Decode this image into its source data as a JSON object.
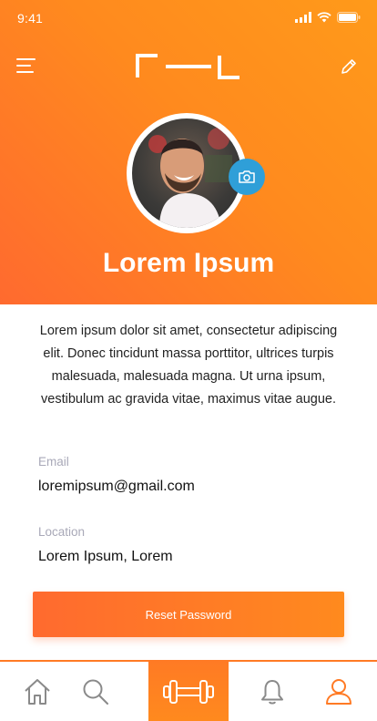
{
  "status_bar": {
    "time": "9:41"
  },
  "header": {
    "profile_name": "Lorem Ipsum"
  },
  "profile": {
    "bio": "Lorem ipsum dolor sit amet, consectetur adipiscing elit. Donec tincidunt massa porttitor, ultrices turpis malesuada, malesuada magna. Ut urna ipsum, vestibulum ac gravida vitae, maximus vitae augue.",
    "email_label": "Email",
    "email_value": "loremipsum@gmail.com",
    "location_label": "Location",
    "location_value": "Lorem Ipsum, Lorem"
  },
  "actions": {
    "reset_password_label": "Reset Password"
  },
  "tabs": [
    {
      "icon": "home-icon",
      "active": false
    },
    {
      "icon": "search-icon",
      "active": false
    },
    {
      "icon": "dumbbell-icon",
      "active": false
    },
    {
      "icon": "bell-icon",
      "active": false
    },
    {
      "icon": "user-icon",
      "active": true
    }
  ],
  "colors": {
    "accent": "#ff7a24",
    "accent_dark": "#ff6a2f",
    "camera_badge": "#2f9fd8",
    "label_gray": "#a9a9b8",
    "tab_icon": "#8a8a8a"
  }
}
